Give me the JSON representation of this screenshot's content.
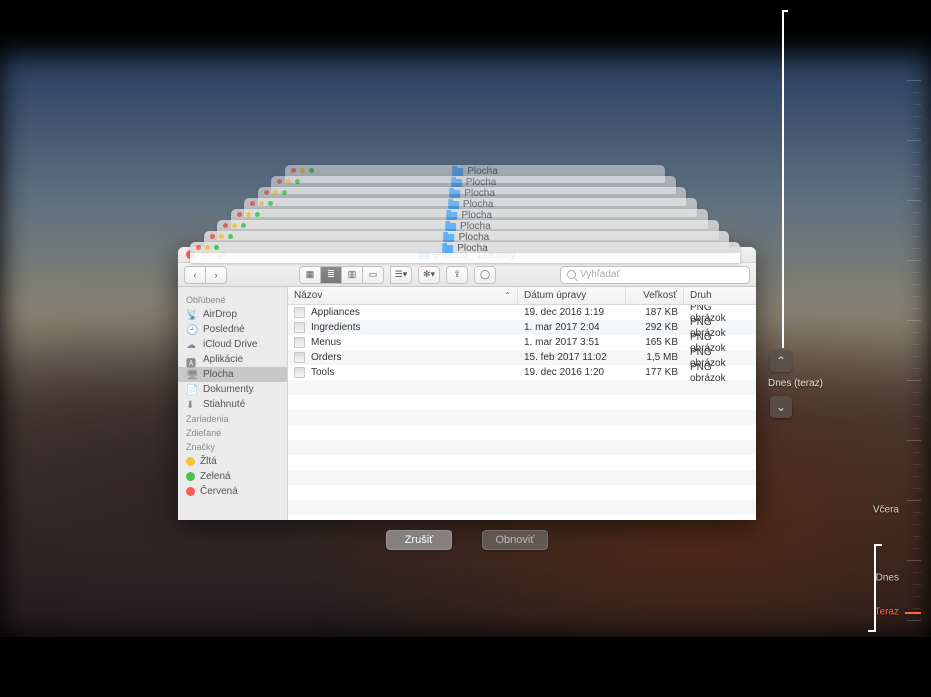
{
  "window": {
    "title": "Plocha - Lokálny",
    "stack_title": "Plocha"
  },
  "toolbar": {
    "search_placeholder": "Vyhľadať"
  },
  "sidebar": {
    "favorites_header": "Obľúbené",
    "devices_header": "Zariadenia",
    "shared_header": "Zdieľané",
    "tags_header": "Značky",
    "favorites": [
      {
        "label": "AirDrop"
      },
      {
        "label": "Posledné"
      },
      {
        "label": "iCloud Drive"
      },
      {
        "label": "Aplikácie"
      },
      {
        "label": "Plocha"
      },
      {
        "label": "Dokumenty"
      },
      {
        "label": "Stiahnuté"
      }
    ],
    "tags": [
      {
        "label": "Žltá",
        "color": "#f5c631"
      },
      {
        "label": "Zelená",
        "color": "#53cászt"
      },
      {
        "label": "Červená",
        "color": "#ff5b52"
      }
    ]
  },
  "columns": {
    "name": "Názov",
    "date": "Dátum úpravy",
    "size": "Veľkosť",
    "kind": "Druh"
  },
  "files": [
    {
      "name": "Appliances",
      "date": "19. dec 2016 1:19",
      "size": "187 KB",
      "kind": "PNG obrázok"
    },
    {
      "name": "Ingredients",
      "date": "1. mar 2017 2:04",
      "size": "292 KB",
      "kind": "PNG obrázok"
    },
    {
      "name": "Menus",
      "date": "1. mar 2017 3:51",
      "size": "165 KB",
      "kind": "PNG obrázok"
    },
    {
      "name": "Orders",
      "date": "15. feb 2017 11:02",
      "size": "1,5 MB",
      "kind": "PNG obrázok"
    },
    {
      "name": "Tools",
      "date": "19. dec 2016 1:20",
      "size": "177 KB",
      "kind": "PNG obrázok"
    }
  ],
  "controls": {
    "cancel": "Zrušiť",
    "restore": "Obnoviť"
  },
  "timeline": {
    "current": "Dnes (teraz)",
    "labels": {
      "yesterday": "Včera",
      "today": "Dnes",
      "now": "Teraz"
    }
  }
}
